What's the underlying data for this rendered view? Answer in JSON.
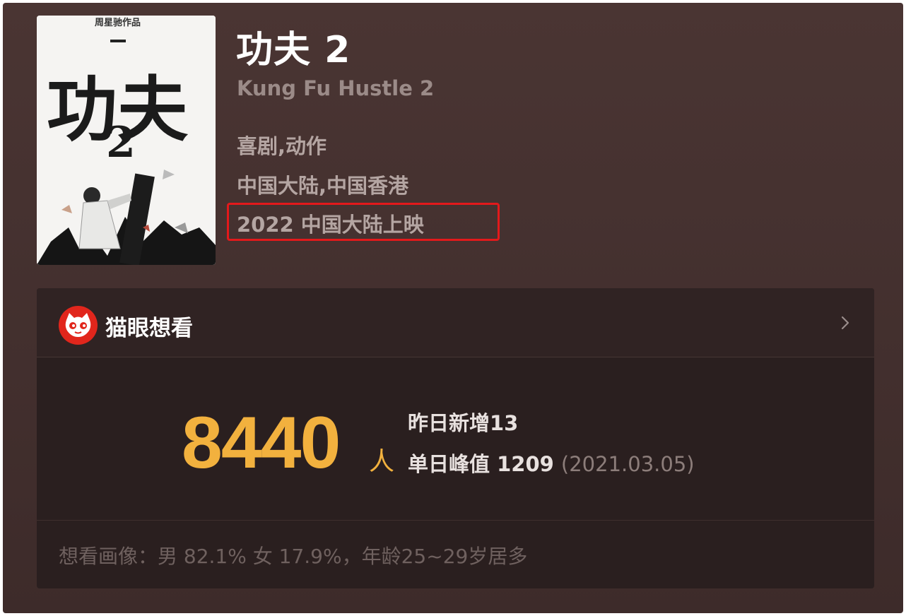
{
  "poster": {
    "top_text": "周星驰作品",
    "logo_text": "功夫",
    "logo_number": "2"
  },
  "movie": {
    "title": "功夫 2",
    "subtitle": "Kung Fu Hustle 2",
    "genres": "喜剧,动作",
    "regions": "中国大陆,中国香港",
    "release": "2022 中国大陆上映"
  },
  "colors": {
    "highlight": "#e3191b",
    "accent": "#f2b13e",
    "maoyan_red": "#e1261c"
  },
  "want_to_see": {
    "header_title": "猫眼想看",
    "logo_icon": "maoyan-cat-icon",
    "chevron_icon": "chevron-right-icon",
    "count": "8440",
    "unit": "人",
    "yesterday": "昨日新增13",
    "peak_label": "单日峰值 1209",
    "peak_date": "(2021.03.05)",
    "profile": "想看画像：男 82.1%   女 17.9%，年龄25~29岁居多"
  }
}
